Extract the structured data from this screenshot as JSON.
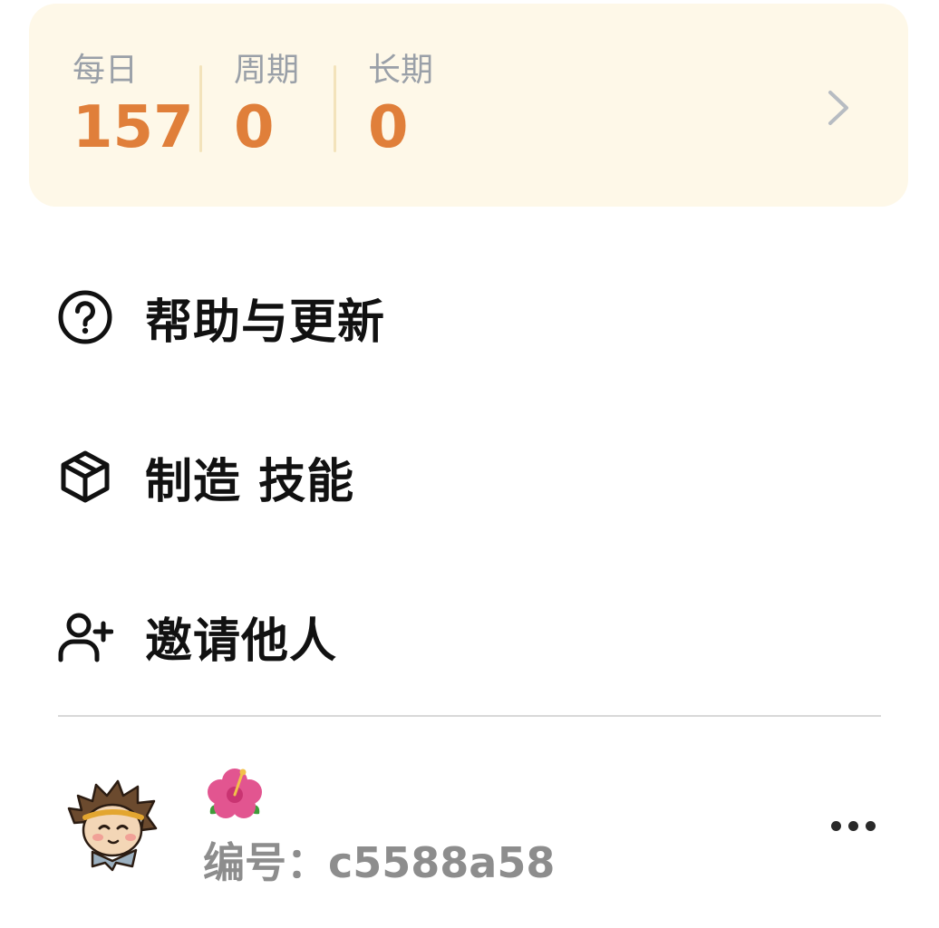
{
  "stats": {
    "items": [
      {
        "label": "每日",
        "value": "157"
      },
      {
        "label": "周期",
        "value": "0"
      },
      {
        "label": "长期",
        "value": "0"
      }
    ],
    "chevron_icon": "chevron-right-icon",
    "colors": {
      "background": "#fef8e8",
      "value": "#e07f3a",
      "label": "#9aa0a8"
    }
  },
  "menu": {
    "items": [
      {
        "label": "帮助与更新",
        "icon": "help-circle-icon"
      },
      {
        "label": "制造 技能",
        "icon": "package-icon"
      },
      {
        "label": "邀请他人",
        "icon": "user-plus-icon"
      }
    ]
  },
  "profile": {
    "avatar_icon": "monkey-king-avatar",
    "status_emoji_icon": "hibiscus-emoji",
    "id_text": "编号：c5588a58",
    "more_icon": "more-dots-icon"
  }
}
